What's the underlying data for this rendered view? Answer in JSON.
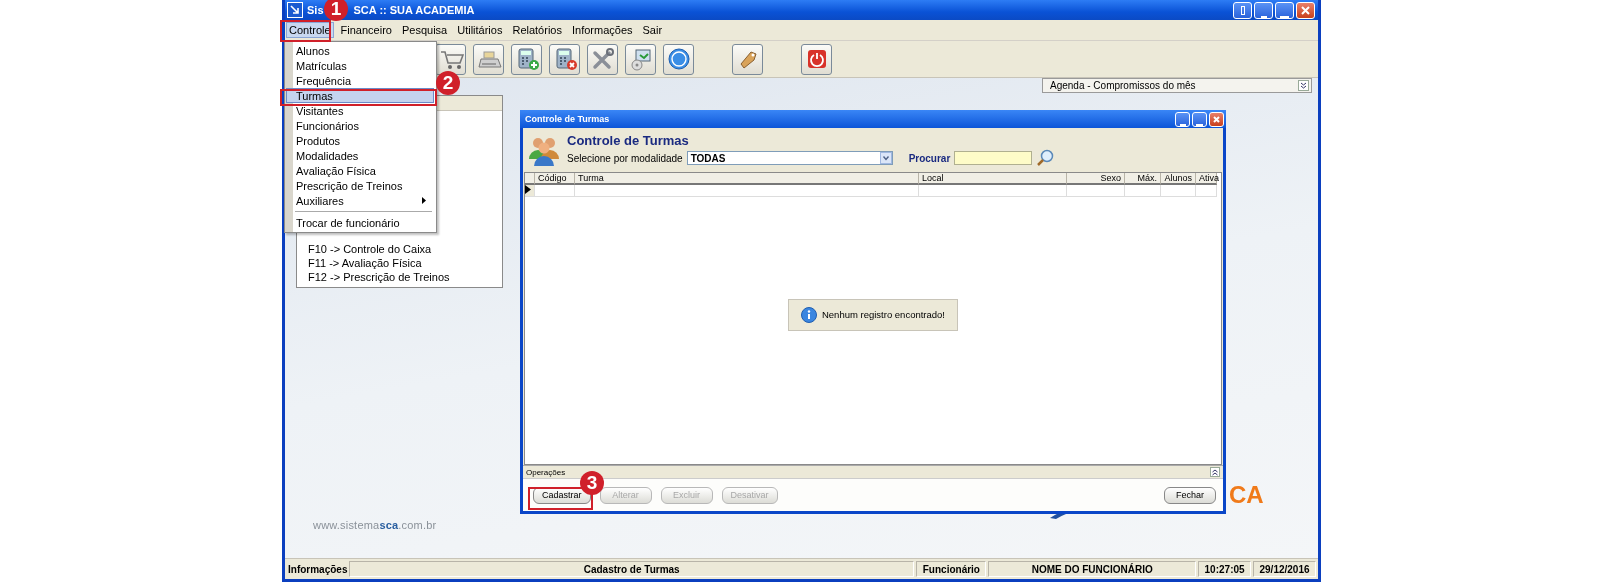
{
  "window": {
    "title_parts": [
      "Sis",
      "SCA :: SUA ACADEMIA"
    ]
  },
  "menubar": [
    {
      "label": "Controle",
      "selected": true
    },
    {
      "label": "Financeiro",
      "selected": false
    },
    {
      "label": "Pesquisa",
      "selected": false
    },
    {
      "label": "Utilitários",
      "selected": false
    },
    {
      "label": "Relatórios",
      "selected": false
    },
    {
      "label": "Informações",
      "selected": false
    },
    {
      "label": "Sair",
      "selected": false
    }
  ],
  "controle_menu": [
    {
      "kind": "item",
      "label": "Alunos",
      "selected": false
    },
    {
      "kind": "item",
      "label": "Matrículas",
      "selected": false
    },
    {
      "kind": "item",
      "label": "Frequência",
      "selected": false
    },
    {
      "kind": "item",
      "label": "Turmas",
      "selected": true
    },
    {
      "kind": "item",
      "label": "Visitantes",
      "selected": false
    },
    {
      "kind": "item",
      "label": "Funcionários",
      "selected": false
    },
    {
      "kind": "item",
      "label": "Produtos",
      "selected": false
    },
    {
      "kind": "item",
      "label": "Modalidades",
      "selected": false
    },
    {
      "kind": "item",
      "label": "Avaliação Física",
      "selected": false
    },
    {
      "kind": "item",
      "label": "Prescrição de Treinos",
      "selected": false
    },
    {
      "kind": "submenu",
      "label": "Auxiliares",
      "selected": false
    },
    {
      "kind": "separator"
    },
    {
      "kind": "item",
      "label": "Trocar de funcionário",
      "selected": false
    }
  ],
  "toolbar": [
    {
      "kind": "cart"
    },
    {
      "kind": "register"
    },
    {
      "kind": "calc-add"
    },
    {
      "kind": "calc-remove"
    },
    {
      "kind": "tools"
    },
    {
      "kind": "computer"
    },
    {
      "kind": "help"
    },
    {
      "kind": "tag"
    },
    {
      "kind": "power"
    }
  ],
  "agenda": {
    "title": "Agenda - Compromissos do mês"
  },
  "shortcuts_panel": {
    "items": [
      "F10 -> Controle do Caixa",
      "F11 -> Avaliação Física",
      "F12 -> Prescrição de Treinos"
    ]
  },
  "dialog": {
    "title": "Controle de Turmas",
    "heading": "Controle de Turmas",
    "filter_label": "Selecione por modalidade",
    "filter_value": "TODAS",
    "search_label": "Procurar",
    "table": {
      "columns": [
        "Código",
        "Turma",
        "Local",
        "Sexo",
        "Máx.",
        "Alunos",
        "Ativa"
      ]
    },
    "message": "Nenhum registro encontrado!",
    "operations_label": "Operações",
    "buttons": [
      {
        "label": "Cadastrar",
        "disabled": false
      },
      {
        "label": "Alterar",
        "disabled": true
      },
      {
        "label": "Excluir",
        "disabled": true
      },
      {
        "label": "Desativar",
        "disabled": true
      },
      {
        "label": "Fechar",
        "disabled": false
      }
    ]
  },
  "website": "www.sistema**sca**.com.br",
  "logo": "CA",
  "status_bar": {
    "label": "Informações",
    "fields": [
      "Cadastro de Turmas",
      "Funcionário",
      "NOME DO FUNCIONÁRIO",
      "10:27:05",
      "29/12/2016"
    ]
  },
  "callouts": [
    {
      "number": "1"
    },
    {
      "number": "2"
    },
    {
      "number": "3"
    }
  ]
}
